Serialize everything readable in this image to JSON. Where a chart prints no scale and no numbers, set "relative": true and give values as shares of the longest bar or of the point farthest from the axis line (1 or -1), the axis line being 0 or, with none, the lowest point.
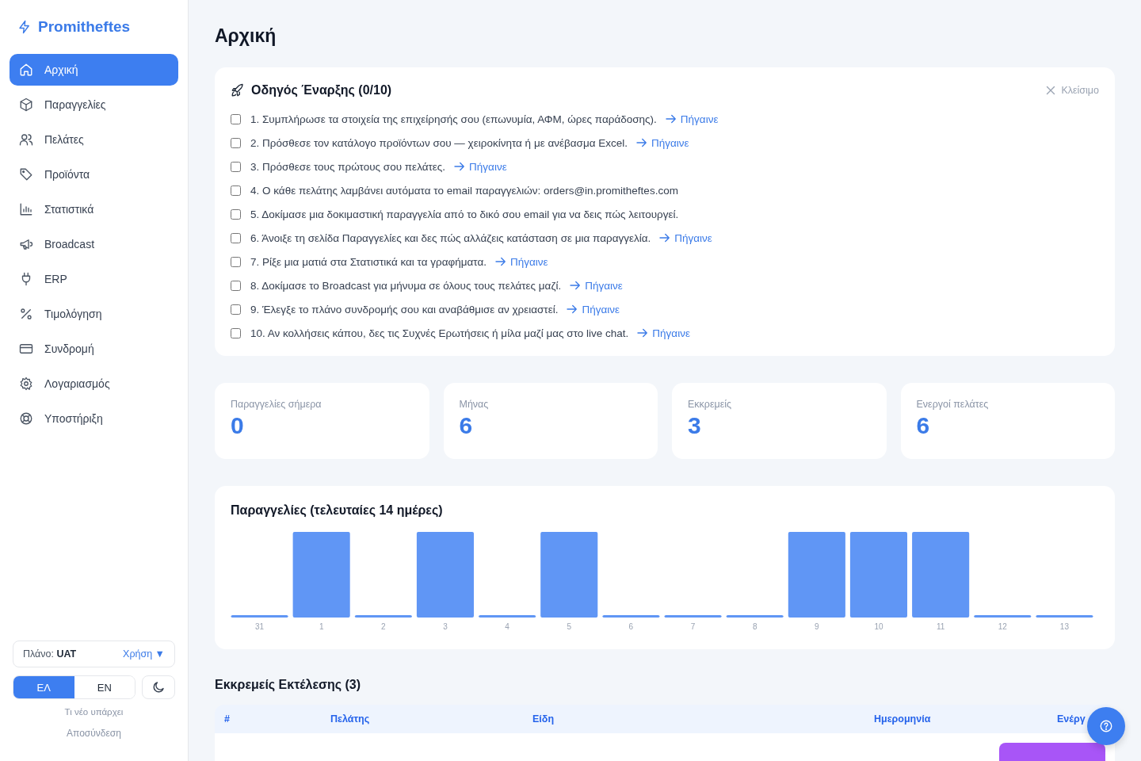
{
  "sidebar": {
    "brand": "Promitheftes",
    "items": [
      {
        "label": "Αρχική",
        "selected": true
      },
      {
        "label": "Παραγγελίες",
        "selected": false
      },
      {
        "label": "Πελάτες",
        "selected": false
      },
      {
        "label": "Προϊόντα",
        "selected": false
      },
      {
        "label": "Στατιστικά",
        "selected": false
      },
      {
        "label": "Broadcast",
        "selected": false
      },
      {
        "label": "ERP",
        "selected": false
      },
      {
        "label": "Τιμολόγηση",
        "selected": false
      },
      {
        "label": "Συνδρομή",
        "selected": false
      },
      {
        "label": "Λογαριασμός",
        "selected": false
      },
      {
        "label": "Υποστήριξη",
        "selected": false
      }
    ],
    "plan": {
      "label": "Πλάνο:",
      "value": "UAT",
      "link": "Χρήση ▼"
    },
    "languages": [
      {
        "label": "ΕΛ",
        "selected": true
      },
      {
        "label": "EN",
        "selected": false
      }
    ],
    "whats_new": "Τι νέο υπάρχει",
    "logout": "Αποσύνδεση"
  },
  "page": {
    "title": "Αρχική"
  },
  "onboarding": {
    "title": "Οδηγός Έναρξης (0/10)",
    "close": "Κλείσιμο",
    "steps": [
      {
        "text": "1. Συμπλήρωσε τα στοιχεία της επιχείρησής σου (επωνυμία, ΑΦΜ, ώρες παράδοσης).",
        "link": "Πήγαινε",
        "checked": false
      },
      {
        "text": "2. Πρόσθεσε τον κατάλογο προϊόντων σου — χειροκίνητα ή με ανέβασμα Excel.",
        "link": "Πήγαινε",
        "checked": false
      },
      {
        "text": "3. Πρόσθεσε τους πρώτους σου πελάτες.",
        "link": "Πήγαινε",
        "checked": false
      },
      {
        "text": "4. Ο κάθε πελάτης λαμβάνει αυτόματα το email παραγγελιών: orders@in.promitheftes.com",
        "checked": false
      },
      {
        "text": "5. Δοκίμασε μια δοκιμαστική παραγγελία από το δικό σου email για να δεις πώς λειτουργεί.",
        "checked": false
      },
      {
        "text": "6. Άνοιξε τη σελίδα Παραγγελίες και δες πώς αλλάζεις κατάσταση σε μια παραγγελία.",
        "link": "Πήγαινε",
        "checked": false
      },
      {
        "text": "7. Ρίξε μια ματιά στα Στατιστικά και τα γραφήματα.",
        "link": "Πήγαινε",
        "checked": false
      },
      {
        "text": "8. Δοκίμασε το Broadcast για μήνυμα σε όλους τους πελάτες μαζί.",
        "link": "Πήγαινε",
        "checked": false
      },
      {
        "text": "9. Έλεγξε το πλάνο συνδρομής σου και αναβάθμισε αν χρειαστεί.",
        "link": "Πήγαινε",
        "checked": false
      },
      {
        "text": "10. Αν κολλήσεις κάπου, δες τις Συχνές Ερωτήσεις ή μίλα μαζί μας στο live chat.",
        "link": "Πήγαινε",
        "checked": false
      }
    ]
  },
  "stats": [
    {
      "label": "Παραγγελίες σήμερα",
      "value": "0"
    },
    {
      "label": "Μήνας",
      "value": "6"
    },
    {
      "label": "Εκκρεμείς",
      "value": "3"
    },
    {
      "label": "Ενεργοί πελάτες",
      "value": "6"
    }
  ],
  "orders_chart": {
    "title": "Παραγγελίες (τελευταίες 14 ημέρες)",
    "chart_data": {
      "type": "bar",
      "relative": true,
      "color": "#6096f5",
      "categories": [
        "31",
        "1",
        "2",
        "3",
        "4",
        "5",
        "6",
        "7",
        "8",
        "9",
        "10",
        "11",
        "12",
        "13"
      ],
      "values": [
        0,
        1,
        0,
        1,
        0,
        1,
        0,
        0,
        0,
        1,
        1,
        1,
        0,
        0
      ]
    }
  },
  "pending": {
    "title": "Εκκρεμείς Εκτέλεσης (3)",
    "columns": [
      "#",
      "Πελάτης",
      "Είδη",
      "Ημερομηνία",
      "Ενέργ"
    ]
  }
}
